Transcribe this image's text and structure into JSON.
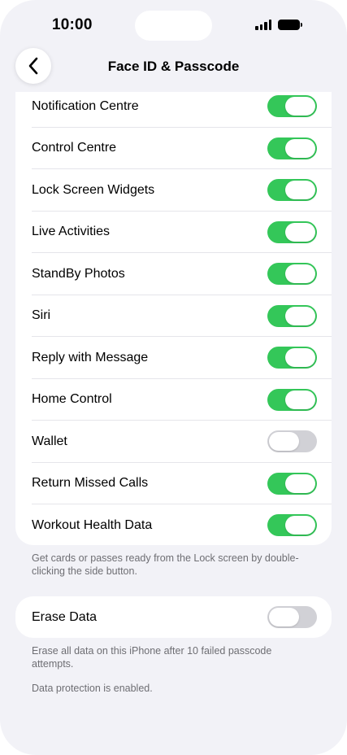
{
  "status_bar": {
    "time": "10:00"
  },
  "nav": {
    "title": "Face ID & Passcode",
    "back_icon": "chevron-left-icon"
  },
  "lock_access": {
    "rows": [
      {
        "label": "Notification Centre",
        "on": true
      },
      {
        "label": "Control Centre",
        "on": true
      },
      {
        "label": "Lock Screen Widgets",
        "on": true
      },
      {
        "label": "Live Activities",
        "on": true
      },
      {
        "label": "StandBy Photos",
        "on": true
      },
      {
        "label": "Siri",
        "on": true
      },
      {
        "label": "Reply with Message",
        "on": true
      },
      {
        "label": "Home Control",
        "on": true
      },
      {
        "label": "Wallet",
        "on": false
      },
      {
        "label": "Return Missed Calls",
        "on": true
      },
      {
        "label": "Workout Health Data",
        "on": true
      }
    ],
    "footer": "Get cards or passes ready from the Lock screen by double-clicking the side button."
  },
  "erase": {
    "label": "Erase Data",
    "on": false,
    "footer": "Erase all data on this iPhone after 10 failed passcode attempts.",
    "footer2": "Data protection is enabled."
  },
  "colors": {
    "toggle_on": "#34c759",
    "toggle_off": "#d1d1d6",
    "background": "#f2f2f7"
  }
}
